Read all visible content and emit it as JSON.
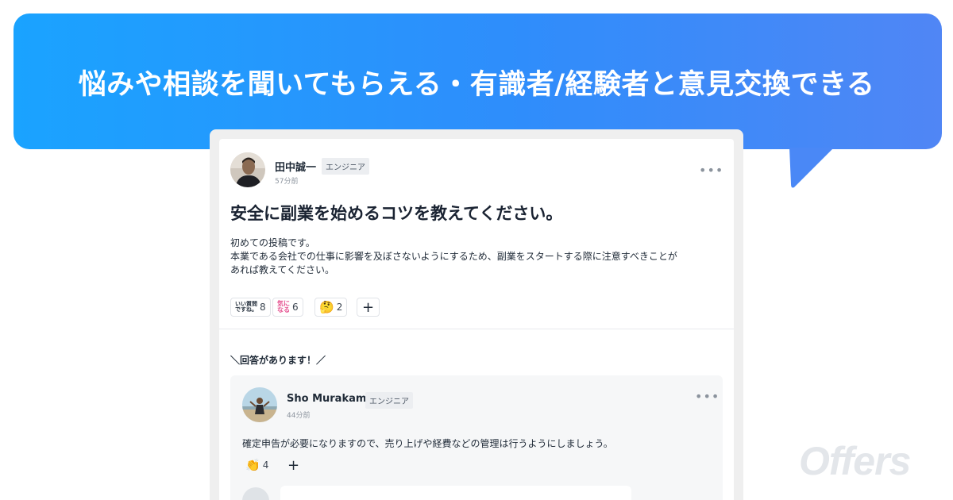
{
  "banner": {
    "headline": "悩みや相談を聞いてもらえる・有識者/経験者と意見交換できる"
  },
  "watermark": "Offers",
  "post": {
    "author": {
      "name": "田中誠一",
      "role": "エンジニア",
      "time": "57分前"
    },
    "title": "安全に副業を始めるコツを教えてください。",
    "body": [
      "初めての投稿です。",
      "本業である会社での仕事に影響を及ぼさないようにするため、副業をスタートする際に注意すべきことが",
      "あれば教えてください。"
    ],
    "reactions": [
      {
        "icon": "good-question-stamp-icon",
        "stamp_lines": [
          "いい質問",
          "ですね。"
        ],
        "count": "8"
      },
      {
        "icon": "curious-stamp-icon",
        "stamp_lines": [
          "気に",
          "なる"
        ],
        "count": "6",
        "color": "#e5508f"
      },
      {
        "icon": "thinking-face-icon",
        "glyph": "🤔",
        "count": "2"
      }
    ],
    "add_reaction_label": "+"
  },
  "answers": {
    "heading": "＼回答があります！／",
    "items": [
      {
        "author": {
          "name": "Sho Murakami",
          "role": "エンジニア",
          "time": "44分前"
        },
        "text": "確定申告が必要になりますので、売り上げや経費などの管理は行うようにしましょう。",
        "reactions": [
          {
            "icon": "clapping-hands-icon",
            "glyph": "👏",
            "count": "4"
          }
        ],
        "add_reaction_label": "+"
      }
    ]
  },
  "colors": {
    "banner_start": "#1aa3ff",
    "banner_end": "#5086f5",
    "title_text": "#1a2332"
  }
}
